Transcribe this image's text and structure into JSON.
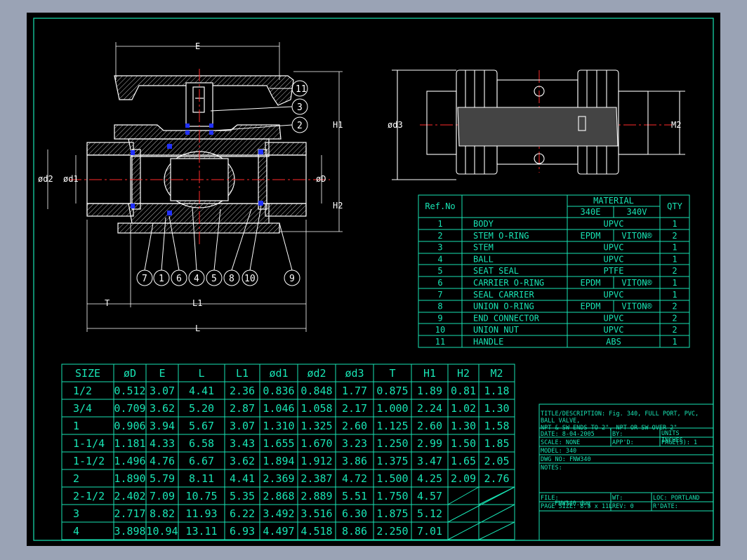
{
  "colors": {
    "background": "#000000",
    "frame": "#18e4b4",
    "part": "#ffffff",
    "hatch": "#c8c8c8",
    "centerline": "#ff2a2a",
    "oring": "#2030ff",
    "screen": "#9aa3b5"
  },
  "dims": {
    "E": "E",
    "H1": "H1",
    "H2": "H2",
    "D": "øD",
    "d1": "ød1",
    "d2": "ød2",
    "d3": "ød3",
    "M2": "M2",
    "T": "T",
    "L1": "L1",
    "L": "L"
  },
  "balloons_top": [
    "11",
    "3",
    "2"
  ],
  "balloons_bottom": [
    "7",
    "1",
    "6",
    "4",
    "5",
    "8",
    "10",
    "9"
  ],
  "parts": {
    "headers": {
      "ref": "Ref.No",
      "material": "MATERIAL",
      "qty": "QTY",
      "m1": "340E",
      "m2": "340V"
    },
    "rows": [
      {
        "ref": "1",
        "name": "BODY",
        "mat": "UPVC",
        "qty": "1"
      },
      {
        "ref": "2",
        "name": "STEM O-RING",
        "m1": "EPDM",
        "m2": "VITON®",
        "qty": "2"
      },
      {
        "ref": "3",
        "name": "STEM",
        "mat": "UPVC",
        "qty": "1"
      },
      {
        "ref": "4",
        "name": "BALL",
        "mat": "UPVC",
        "qty": "1"
      },
      {
        "ref": "5",
        "name": "SEAT SEAL",
        "mat": "PTFE",
        "qty": "2"
      },
      {
        "ref": "6",
        "name": "CARRIER O-RING",
        "m1": "EPDM",
        "m2": "VITON®",
        "qty": "1"
      },
      {
        "ref": "7",
        "name": "SEAL CARRIER",
        "mat": "UPVC",
        "qty": "1"
      },
      {
        "ref": "8",
        "name": "UNION O-RING",
        "m1": "EPDM",
        "m2": "VITON®",
        "qty": "2"
      },
      {
        "ref": "9",
        "name": "END CONNECTOR",
        "mat": "UPVC",
        "qty": "2"
      },
      {
        "ref": "10",
        "name": "UNION NUT",
        "mat": "UPVC",
        "qty": "2"
      },
      {
        "ref": "11",
        "name": "HANDLE",
        "mat": "ABS",
        "qty": "1"
      }
    ]
  },
  "sizes": {
    "headers": [
      "SIZE",
      "øD",
      "E",
      "L",
      "L1",
      "ød1",
      "ød2",
      "ød3",
      "T",
      "H1",
      "H2",
      "M2"
    ],
    "rows": [
      [
        "1/2",
        "0.512",
        "3.07",
        "4.41",
        "2.36",
        "0.836",
        "0.848",
        "1.77",
        "0.875",
        "1.89",
        "0.81",
        "1.18"
      ],
      [
        "3/4",
        "0.709",
        "3.62",
        "5.20",
        "2.87",
        "1.046",
        "1.058",
        "2.17",
        "1.000",
        "2.24",
        "1.02",
        "1.30"
      ],
      [
        "1",
        "0.906",
        "3.94",
        "5.67",
        "3.07",
        "1.310",
        "1.325",
        "2.60",
        "1.125",
        "2.60",
        "1.30",
        "1.58"
      ],
      [
        "1-1/4",
        "1.181",
        "4.33",
        "6.58",
        "3.43",
        "1.655",
        "1.670",
        "3.23",
        "1.250",
        "2.99",
        "1.50",
        "1.85"
      ],
      [
        "1-1/2",
        "1.496",
        "4.76",
        "6.67",
        "3.62",
        "1.894",
        "1.912",
        "3.86",
        "1.375",
        "3.47",
        "1.65",
        "2.05"
      ],
      [
        "2",
        "1.890",
        "5.79",
        "8.11",
        "4.41",
        "2.369",
        "2.387",
        "4.72",
        "1.500",
        "4.25",
        "2.09",
        "2.76"
      ],
      [
        "2-1/2",
        "2.402",
        "7.09",
        "10.75",
        "5.35",
        "2.868",
        "2.889",
        "5.51",
        "1.750",
        "4.57",
        "",
        ""
      ],
      [
        "3",
        "2.717",
        "8.82",
        "11.93",
        "6.22",
        "3.492",
        "3.516",
        "6.30",
        "1.875",
        "5.12",
        "",
        ""
      ],
      [
        "4",
        "3.898",
        "10.94",
        "13.11",
        "6.93",
        "4.497",
        "4.518",
        "8.86",
        "2.250",
        "7.01",
        "",
        ""
      ]
    ]
  },
  "title_block": {
    "title1": "TITLE/DESCRIPTION:  Fig. 340, FULL PORT, PVC,",
    "title2": "BALL VALVE,",
    "title3": "NPT & SW ENDS TO 2\", NPT OR SW OVER 2\"",
    "date": "DATE:  8-04-2005",
    "by": "BY:",
    "units": "UNITS",
    "inches": "INCHES",
    "scale": "SCALE:  NONE",
    "appd": "APP'D:",
    "pages": "PAGE(S):  1",
    "model": "MODEL:  340",
    "dwg": "DWG NO:  FNW340",
    "notes": "NOTES:",
    "file": "FILE:",
    "wt": "WT:",
    "loc": "LOC:  PORTLAND",
    "filename": "FNW340.dwg",
    "pagesize": "PAGE SIZE: 8.5 x 11L",
    "rev": "REV:  0",
    "rdate": "R'DATE:"
  }
}
